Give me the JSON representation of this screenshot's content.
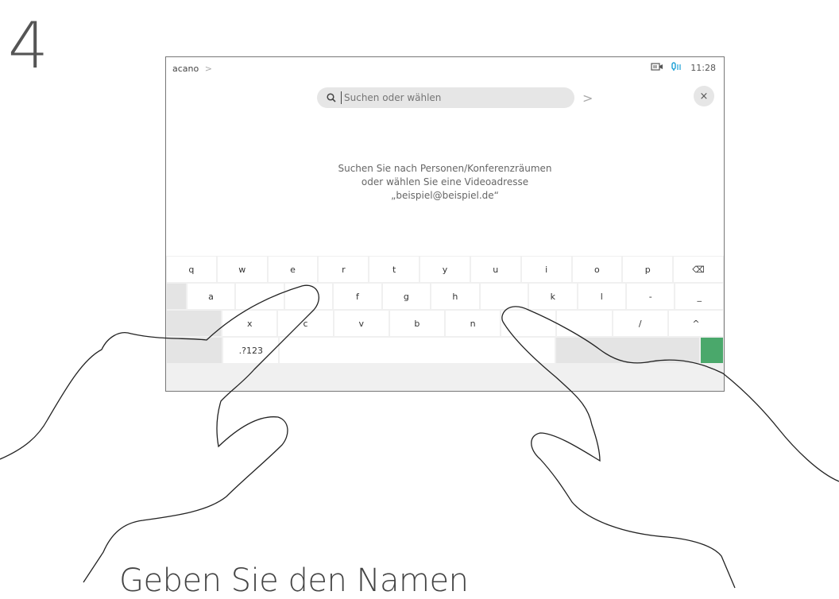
{
  "step": "4",
  "header": {
    "breadcrumb": "acano",
    "breadcrumb_chevron": ">",
    "time": "11:28"
  },
  "search": {
    "placeholder": "Suchen oder wählen",
    "submit_glyph": ">",
    "close_glyph": "×"
  },
  "hint": {
    "line1": "Suchen Sie nach Personen/Konferenzräumen",
    "line2": "oder wählen Sie eine Videoadresse",
    "line3": "„beispiel@beispiel.de“"
  },
  "keyboard": {
    "row1": [
      "q",
      "w",
      "e",
      "r",
      "t",
      "y",
      "u",
      "i",
      "o",
      "p",
      "⌫"
    ],
    "row2": [
      "a",
      "",
      "",
      "f",
      "g",
      "h",
      "",
      "k",
      "l",
      "-",
      "_"
    ],
    "row3": [
      "",
      "x",
      "c",
      "v",
      "b",
      "n",
      "",
      "",
      "/",
      "^",
      ""
    ],
    "row4": {
      "symbols": ".?123"
    }
  },
  "caption": "Geben Sie den Namen",
  "colors": {
    "accent_green": "#4aa86b",
    "mic_blue": "#1a9fd6"
  }
}
